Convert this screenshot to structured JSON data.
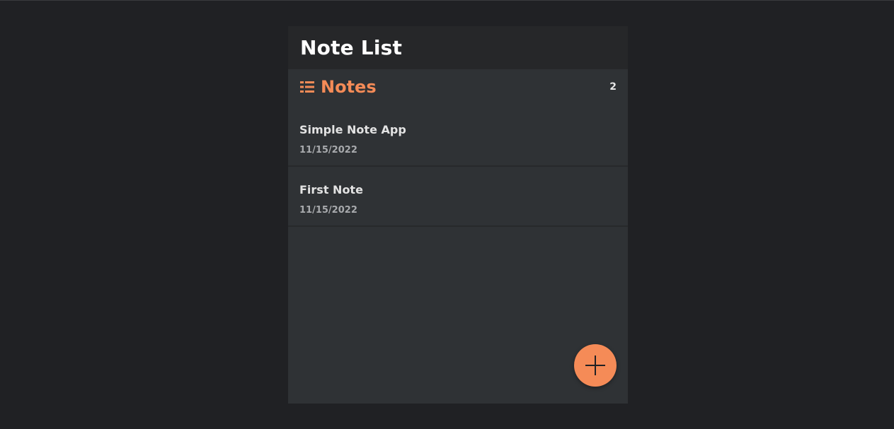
{
  "app": {
    "title": "Note List"
  },
  "notes_section": {
    "title": "Notes",
    "count": "2",
    "icon": "list-icon"
  },
  "notes": [
    {
      "title": "Simple Note App",
      "date": "11/15/2022"
    },
    {
      "title": "First Note",
      "date": "11/15/2022"
    }
  ],
  "add_button": {
    "icon": "plus-icon"
  },
  "colors": {
    "page_bg": "#202124",
    "panel_bg": "#2f3235",
    "header_bg": "#262729",
    "accent": "#f58b57",
    "text_primary": "#ffffff",
    "text_secondary": "#a8aaad"
  }
}
